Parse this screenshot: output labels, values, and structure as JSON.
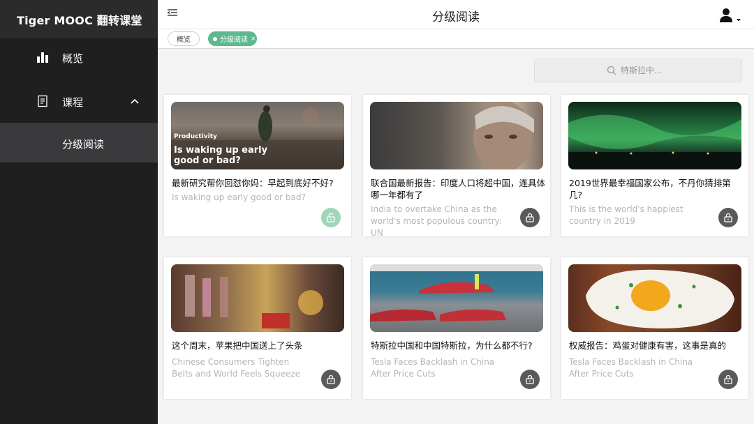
{
  "brand": {
    "title": "Tiger MOOC 翻转课堂"
  },
  "sidebar": {
    "items": [
      {
        "label": "概览",
        "icon": "bar-chart-icon"
      },
      {
        "label": "课程",
        "icon": "document-icon",
        "expanded": true,
        "children": [
          {
            "label": "分级阅读",
            "selected": true
          }
        ]
      }
    ]
  },
  "header": {
    "title": "分级阅读"
  },
  "tabs": [
    {
      "label": "概览"
    },
    {
      "label": "分级阅读",
      "close": "×",
      "active": true
    }
  ],
  "search": {
    "placeholder": "特斯拉中..."
  },
  "colors": {
    "accent": "#5fb88f",
    "sidebar": "#1f1f1f",
    "lock_dark": "#5a5a5a",
    "lock_unlocked": "#9fd6b9"
  },
  "cards": [
    {
      "title": "最新研究帮你回怼你妈：早起到底好不好?",
      "subtitle": "Is waking up early good or bad?",
      "thumb_tag": "Productivity",
      "thumb_caption": "Is waking up early good or bad?",
      "lock": "unlocked"
    },
    {
      "title": "联合国最新报告：印度人口将超中国，连具体哪一年都有了",
      "subtitle": "India to overtake China as the world's most populous country: UN",
      "lock": "locked"
    },
    {
      "title": "2019世界最幸福国家公布，不丹你猜排第几?",
      "subtitle": "This is the world's happiest country in 2019",
      "lock": "locked"
    },
    {
      "title": "这个周末，苹果把中国送上了头条",
      "subtitle": "Chinese Consumers Tighten Belts and World Feels Squeeze",
      "lock": "locked"
    },
    {
      "title": "特斯拉中国和中国特斯拉，为什么都不行?",
      "subtitle": "Tesla Faces Backlash in China After Price Cuts",
      "lock": "locked"
    },
    {
      "title": "权威报告：鸡蛋对健康有害，这事是真的",
      "subtitle": "Tesla Faces Backlash in China After Price Cuts",
      "lock": "locked"
    }
  ]
}
